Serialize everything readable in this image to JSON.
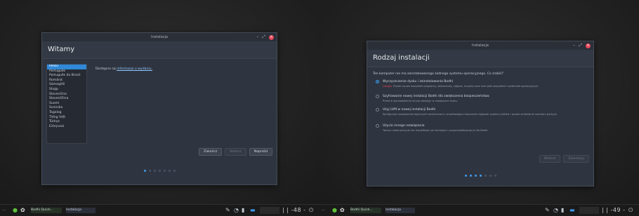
{
  "left_window": {
    "title": "Instalacja",
    "heading": "Witamy",
    "languages": [
      "Polski",
      "Português",
      "Português do Brasil",
      "Română",
      "Sámegillii",
      "Shqip",
      "Slovenčina",
      "Slovenščina",
      "Suomi",
      "Svenska",
      "Tagalog",
      "Tiếng Việt",
      "Türkçe",
      "Ελληνικά"
    ],
    "selected_language": "Polski",
    "notes_prefix": "Dostępne są",
    "notes_link": "informacje o wydaniu.",
    "buttons": {
      "quit": "Zakończ",
      "back": "Wstecz",
      "next": "Naprzód"
    },
    "progress": {
      "total": 7,
      "current": 1
    }
  },
  "right_window": {
    "title": "Instalacja",
    "heading": "Rodzaj instalacji",
    "question": "Ten komputer nie ma zainstalowanego żadnego systemu operacyjnego. Co zrobić?",
    "options": [
      {
        "label": "Wyczyszczenie dysku i zainstalowanie Bodhi",
        "desc_warn": "Uwaga:",
        "desc": "Trwale usuwa wszystkie programy, dokumenty, zdjęcia, muzykę oraz inne pliki wszystkich systemów operacyjnych.",
        "selected": true
      },
      {
        "label": "Szyfrowanie nowej instalacji Bodhi dla zwiększenia bezpieczeństwa",
        "desc": "Przed w wprowadzeniu klucza dostępu w następnym kroku.",
        "selected": false
      },
      {
        "label": "Użyj LVM w nowej instalacji Bodhi",
        "desc": "Konfiguruje zarządzanie logicznymi wolumenami, umożliwiające tworzenie migawek systemu plików i proste zmienianie rozmiaru partycji.",
        "selected": false
      },
      {
        "label": "Użycie innego rozwiązania",
        "desc": "Tworzy nowe partycje lub modyfikuje już istniejące i przyporządkowuje je dla Bodhi.",
        "selected": false
      }
    ],
    "buttons": {
      "back": "Wstecz",
      "next": "Zainstaluj"
    },
    "progress": {
      "total": 7,
      "current": 4
    }
  },
  "taskbar": {
    "left": {
      "app1": "Bodhi Quick...",
      "app2": "Instalacja",
      "clock": "| | -48 ‑"
    },
    "right": {
      "app1": "Bodhi Quick...",
      "app2": "Instalacja",
      "clock": "| | -49 ‑"
    }
  },
  "colors": {
    "accent": "#3d9cf0",
    "close": "#e8475a",
    "selection": "#2f88d8"
  }
}
